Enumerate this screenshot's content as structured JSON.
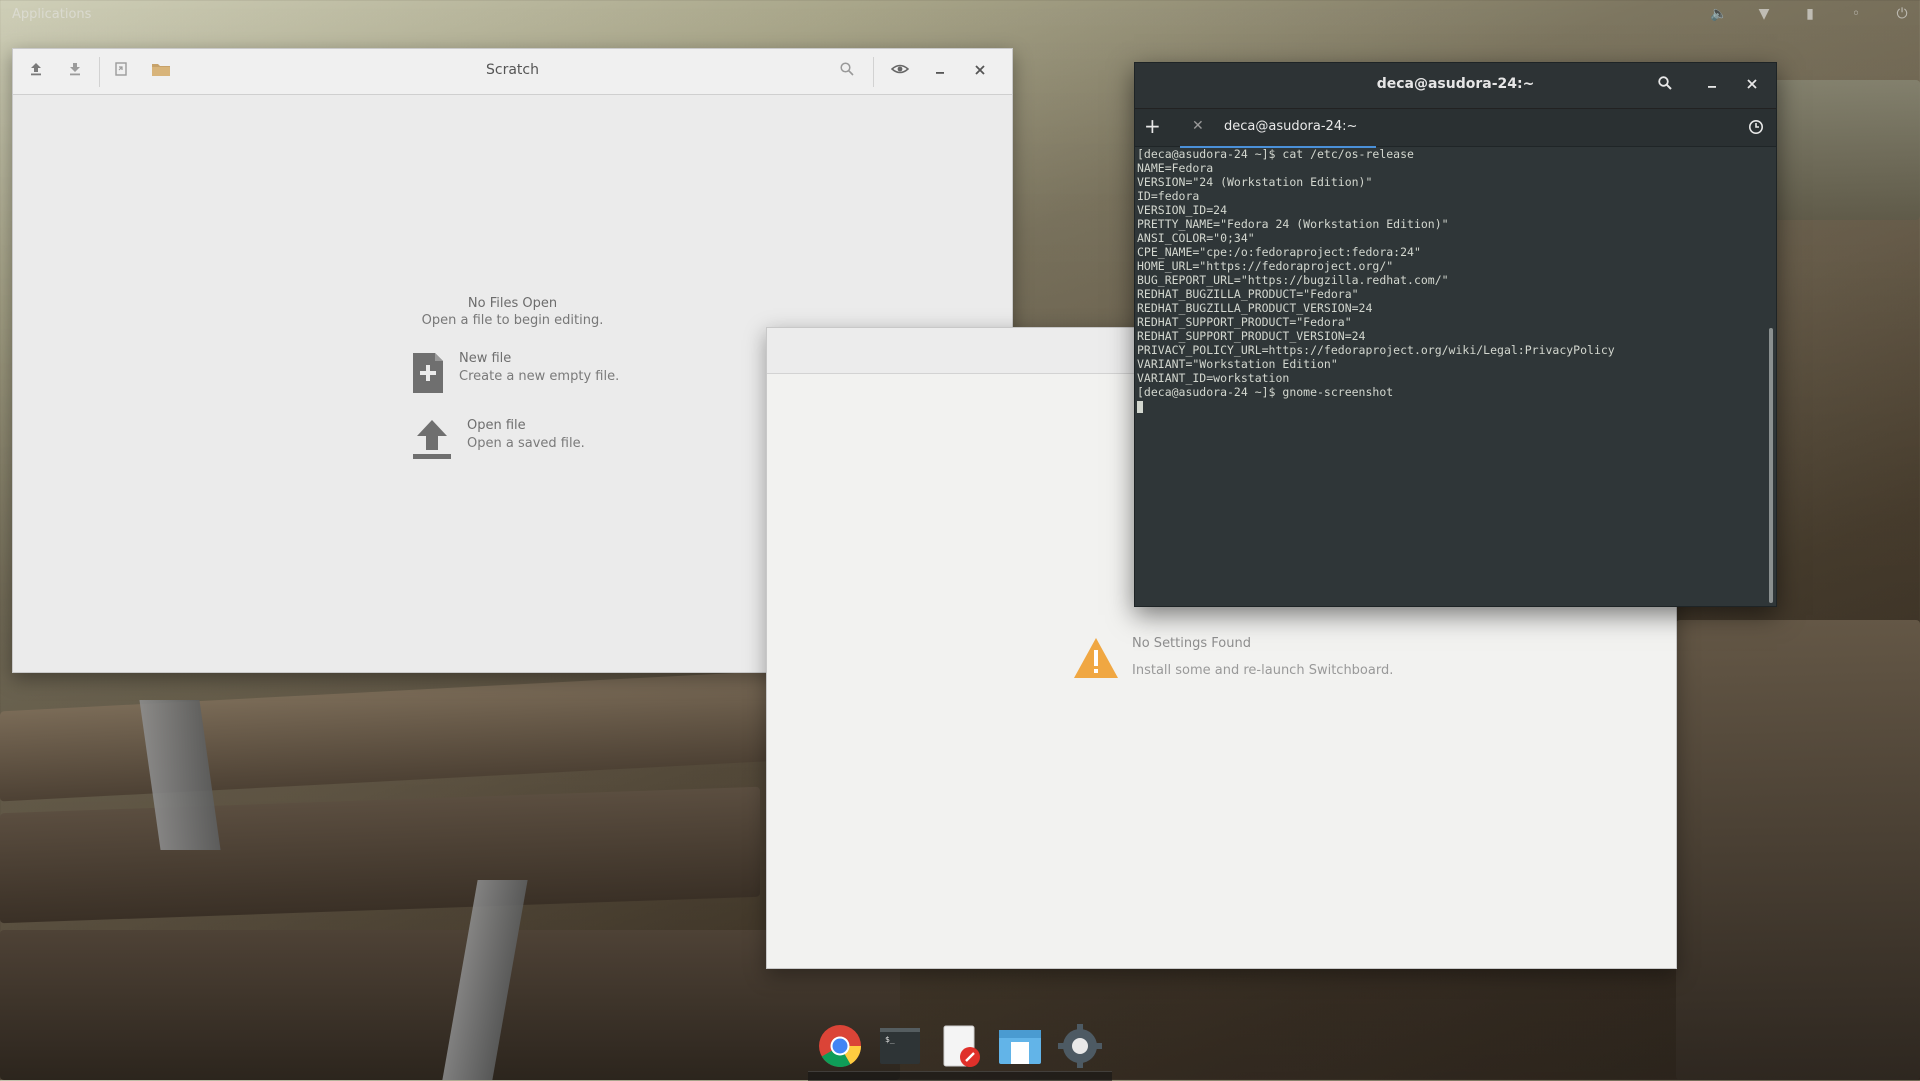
{
  "top_panel": {
    "applications_label": "Applications",
    "tray_icons": [
      "volume-icon",
      "wifi-icon",
      "battery-icon",
      "notification-icon",
      "power-icon"
    ]
  },
  "scratch": {
    "title": "Scratch",
    "toolbar": [
      "open-icon",
      "save-icon",
      "revert-icon",
      "folder-icon",
      "search-icon",
      "preview-icon",
      "minimize-icon",
      "close-icon"
    ],
    "empty_title": "No Files Open",
    "empty_subtitle": "Open a file to begin editing.",
    "new_file_label": "New file",
    "new_file_desc": "Create a new empty file.",
    "open_file_label": "Open file",
    "open_file_desc": "Open a saved file."
  },
  "switchboard": {
    "no_settings_title": "No Settings Found",
    "no_settings_desc": "Install some and re-launch Switchboard."
  },
  "terminal": {
    "title": "deca@asudora-24:~",
    "tab_label": "deca@asudora-24:~",
    "output": "[deca@asudora-24 ~]$ cat /etc/os-release\nNAME=Fedora\nVERSION=\"24 (Workstation Edition)\"\nID=fedora\nVERSION_ID=24\nPRETTY_NAME=\"Fedora 24 (Workstation Edition)\"\nANSI_COLOR=\"0;34\"\nCPE_NAME=\"cpe:/o:fedoraproject:fedora:24\"\nHOME_URL=\"https://fedoraproject.org/\"\nBUG_REPORT_URL=\"https://bugzilla.redhat.com/\"\nREDHAT_BUGZILLA_PRODUCT=\"Fedora\"\nREDHAT_BUGZILLA_PRODUCT_VERSION=24\nREDHAT_SUPPORT_PRODUCT=\"Fedora\"\nREDHAT_SUPPORT_PRODUCT_VERSION=24\nPRIVACY_POLICY_URL=https://fedoraproject.org/wiki/Legal:PrivacyPolicy\nVARIANT=\"Workstation Edition\"\nVARIANT_ID=workstation\n[deca@asudora-24 ~]$ gnome-screenshot"
  },
  "dock": {
    "items": [
      "chrome-icon",
      "terminal-icon",
      "scratch-editor-icon",
      "appcenter-icon",
      "settings-icon"
    ]
  },
  "colors": {
    "accent": "#4a90d9",
    "warning": "#f0a742",
    "terminal_bg": "#2f3638"
  }
}
